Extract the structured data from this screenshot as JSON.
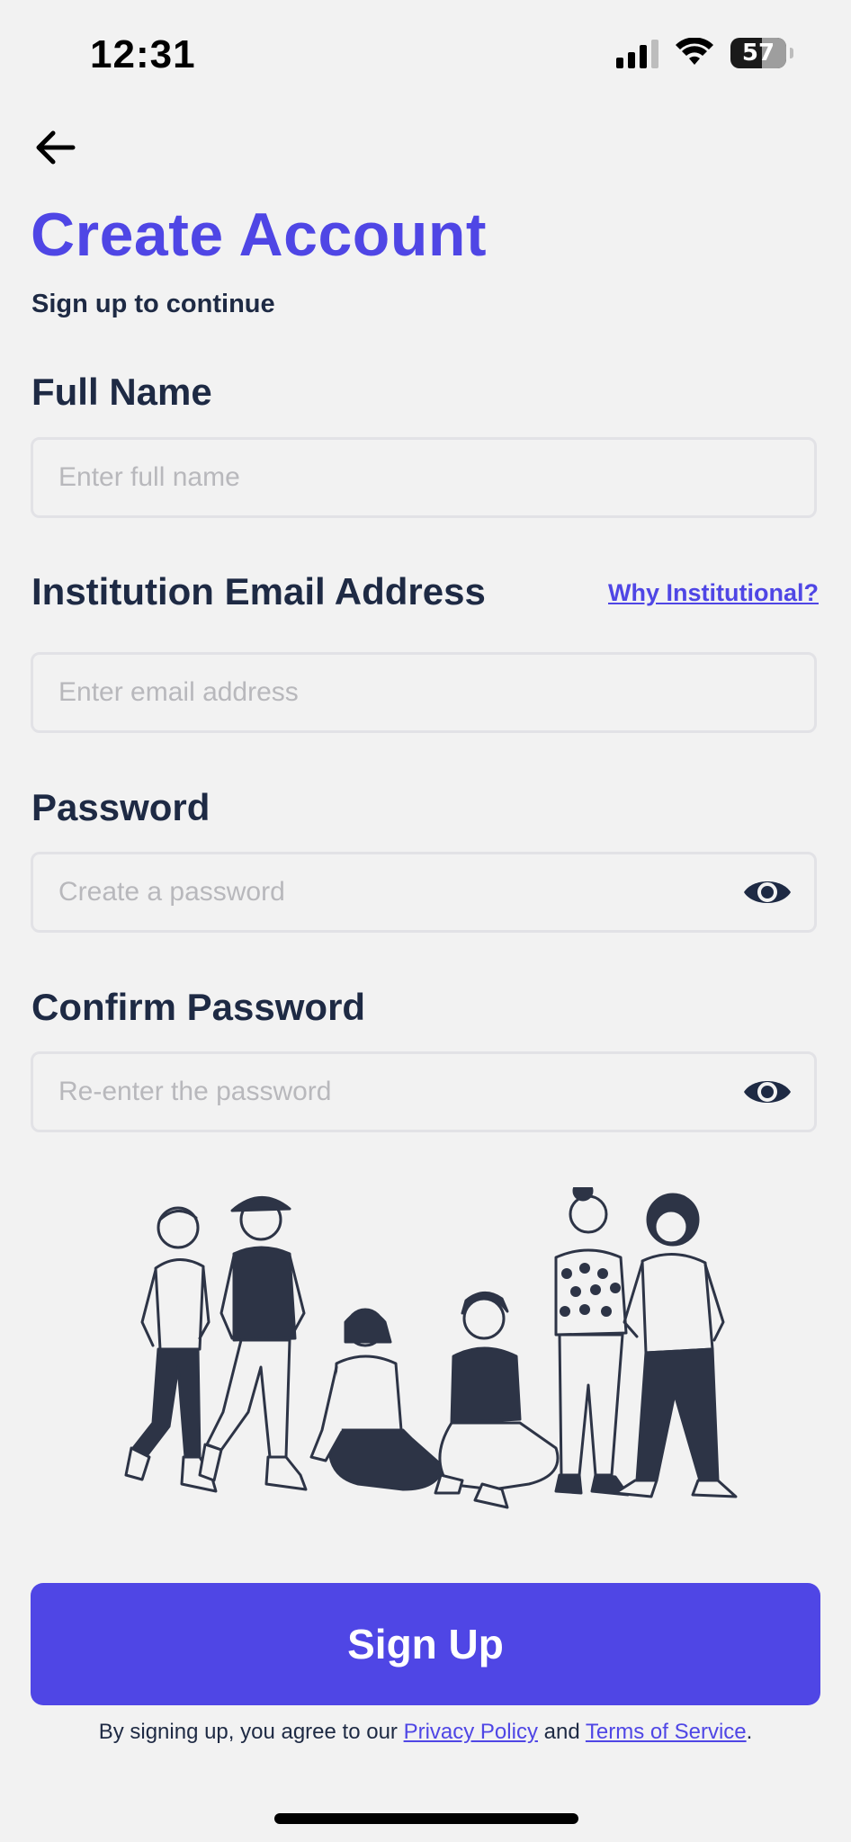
{
  "status_bar": {
    "time": "12:31",
    "battery_level": "57"
  },
  "header": {
    "title": "Create Account",
    "subtitle": "Sign up to continue"
  },
  "form": {
    "full_name": {
      "label": "Full Name",
      "placeholder": "Enter full name",
      "value": ""
    },
    "email": {
      "label": "Institution Email Address",
      "helper_link": "Why Institutional?",
      "placeholder": "Enter email address",
      "value": ""
    },
    "password": {
      "label": "Password",
      "placeholder": "Create a password",
      "value": ""
    },
    "confirm_password": {
      "label": "Confirm Password",
      "placeholder": "Re-enter the password",
      "value": ""
    }
  },
  "actions": {
    "signup_label": "Sign Up"
  },
  "legal": {
    "prefix": "By signing up, you agree to our ",
    "privacy_link": "Privacy Policy",
    "conjunction": " and ",
    "terms_link": "Terms of Service",
    "suffix": "."
  },
  "icons": {
    "back": "arrow-left-icon",
    "toggle_password": "eye-icon",
    "signal": "cellular-signal-icon",
    "wifi": "wifi-icon",
    "battery": "battery-icon"
  },
  "colors": {
    "accent": "#4f46e5",
    "text": "#1e2a44",
    "background": "#f2f2f2",
    "placeholder": "#b8b8bc"
  }
}
